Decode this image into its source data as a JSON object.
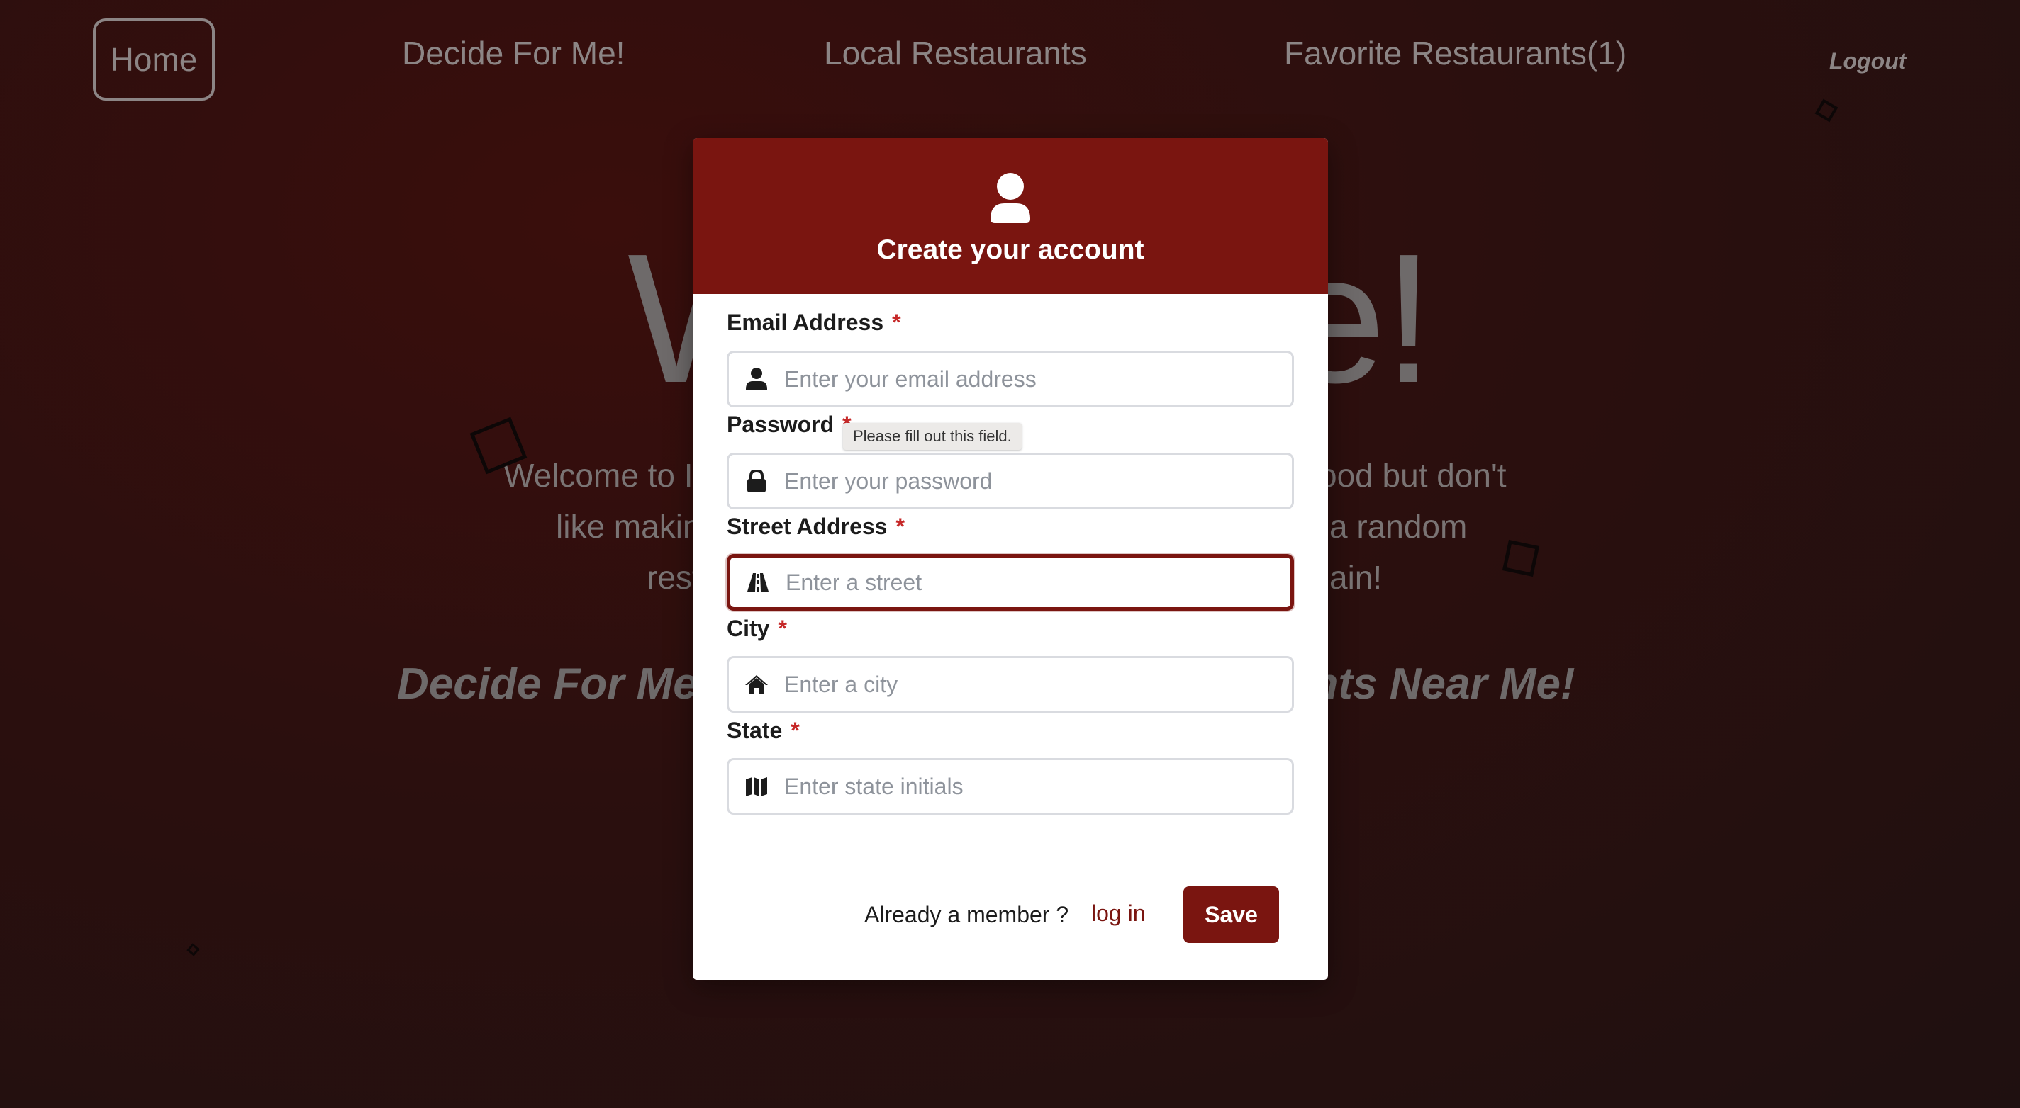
{
  "nav": {
    "home": "Home",
    "decide": "Decide For Me!",
    "local": "Local Restaurants",
    "favorites": "Favorite Restaurants(1)",
    "logout": "Logout"
  },
  "hero": {
    "title_partial": "W                  e!",
    "text_line1": "Welcome to I                                                           ood but don't",
    "text_line2": "like makin                                                           a random",
    "text_line3": "rest                                                                   ain!",
    "sub_partial": "Decide For Me                                                 ants Near Me!"
  },
  "modal": {
    "title": "Create your account",
    "fields": [
      {
        "label": "Email Address",
        "placeholder": "Enter your email address",
        "icon": "user-icon"
      },
      {
        "label": "Password",
        "placeholder": "Enter your password",
        "icon": "lock-icon"
      },
      {
        "label": "Street Address",
        "placeholder": "Enter a street",
        "icon": "road-icon"
      },
      {
        "label": "City",
        "placeholder": "Enter a city",
        "icon": "home-icon"
      },
      {
        "label": "State",
        "placeholder": "Enter state initials",
        "icon": "map-icon"
      }
    ],
    "required_mark": "*",
    "tooltip": "Please fill out this field.",
    "footer_text": "Already a member ?",
    "login_label": "log in",
    "save_label": "Save"
  },
  "colors": {
    "accent": "#7a1510",
    "required": "#c62828"
  }
}
